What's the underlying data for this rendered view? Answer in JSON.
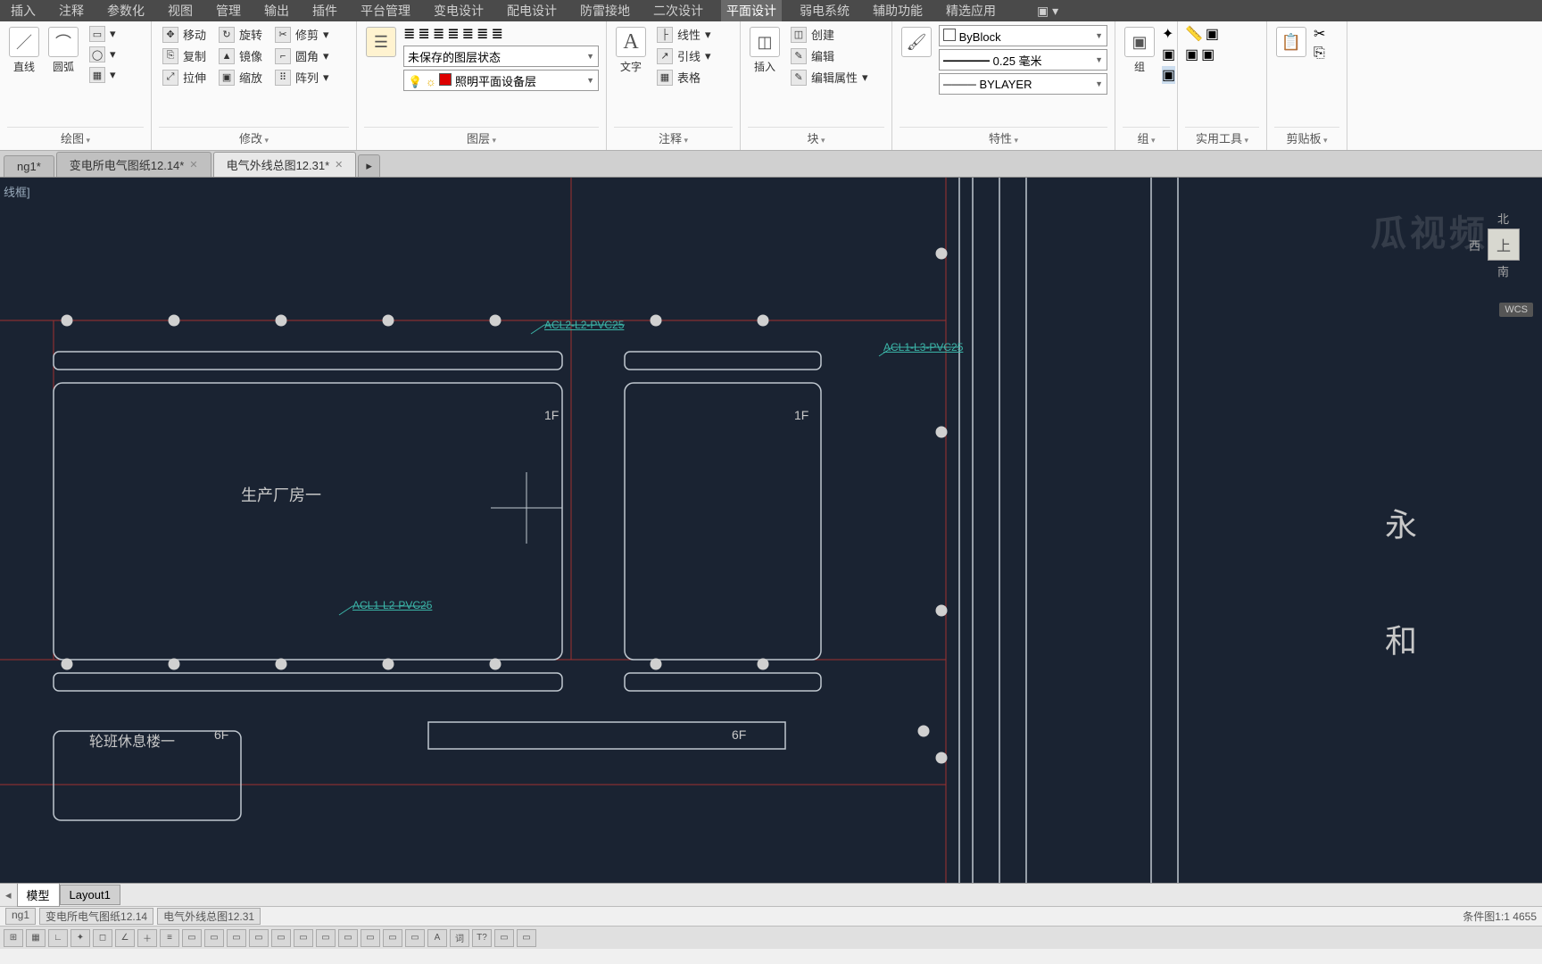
{
  "menu": [
    "插入",
    "注释",
    "参数化",
    "视图",
    "管理",
    "输出",
    "插件",
    "平台管理",
    "变电设计",
    "配电设计",
    "防雷接地",
    "二次设计",
    "平面设计",
    "弱电系统",
    "辅助功能",
    "精选应用"
  ],
  "ribbon": {
    "draw": {
      "title": "绘图",
      "b1": "直线",
      "b2": "圆弧"
    },
    "modify": {
      "title": "修改",
      "r1": [
        "移动",
        "旋转",
        "修剪"
      ],
      "r2": [
        "复制",
        "镜像",
        "圆角"
      ],
      "r3": [
        "拉伸",
        "缩放",
        "阵列"
      ]
    },
    "layer": {
      "title": "图层",
      "state": "未保存的图层状态",
      "current": "照明平面设备层"
    },
    "annotate": {
      "title": "注释",
      "text": "文字",
      "r1": "线性",
      "r2": "引线",
      "r3": "表格"
    },
    "block": {
      "title": "块",
      "insert": "插入",
      "r1": "创建",
      "r2": "编辑",
      "r3": "编辑属性"
    },
    "props": {
      "title": "特性",
      "color": "ByBlock",
      "lw": "0.25 毫米",
      "lt": "BYLAYER"
    },
    "group": {
      "title": "组",
      "btn": "组"
    },
    "util": {
      "title": "实用工具"
    },
    "clip": {
      "title": "剪贴板"
    }
  },
  "tabs": {
    "t1": "ng1*",
    "t2": "变电所电气图纸12.14*",
    "t3": "电气外线总图12.31*"
  },
  "canvas": {
    "corner": "线框]",
    "building1": "生产厂房一",
    "building2": "轮班休息楼一",
    "floor1": "1F",
    "floor6": "6F",
    "cable1": "ACL2-L2-PVC25",
    "cable2": "ACL1-L3-PVC25",
    "cable3": "ACL1-L2-PVC25",
    "road1": "永",
    "road2": "和",
    "cube": {
      "n": "北",
      "s": "南",
      "w": "西",
      "top": "上"
    },
    "wcs": "WCS",
    "watermark": "瓜视频"
  },
  "modeltabs": {
    "m": "模型",
    "l": "Layout1"
  },
  "status": {
    "sheets": [
      "ng1",
      "变电所电气图纸12.14",
      "电气外线总图12.31"
    ],
    "right": "条件图1:1   4655"
  }
}
